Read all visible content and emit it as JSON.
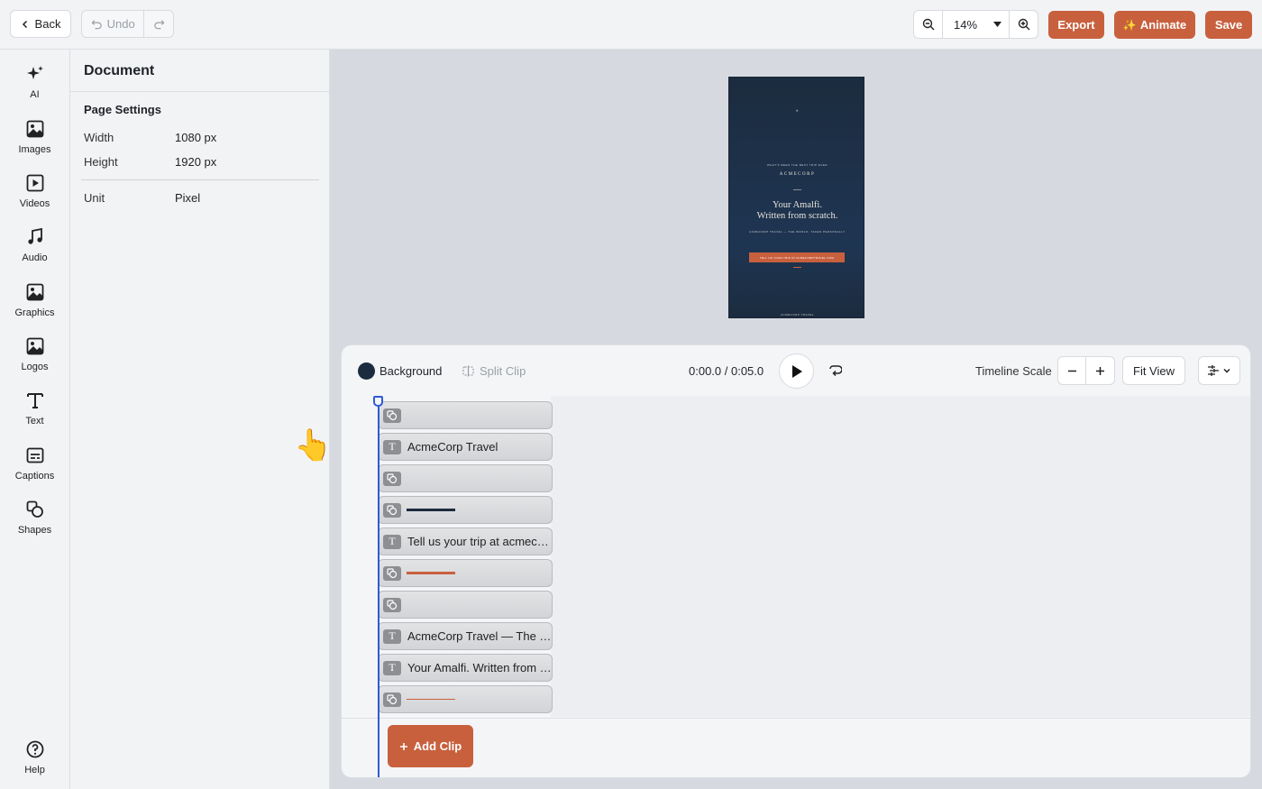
{
  "topbar": {
    "back_label": "Back",
    "undo_label": "Undo",
    "zoom_value": "14%",
    "export_label": "Export",
    "animate_label": "Animate",
    "save_label": "Save"
  },
  "rail": {
    "items": [
      {
        "label": "AI",
        "icon": "sparkle-icon"
      },
      {
        "label": "Images",
        "icon": "image-icon"
      },
      {
        "label": "Videos",
        "icon": "video-icon"
      },
      {
        "label": "Audio",
        "icon": "music-note-icon"
      },
      {
        "label": "Graphics",
        "icon": "graphics-icon"
      },
      {
        "label": "Logos",
        "icon": "logo-icon"
      },
      {
        "label": "Text",
        "icon": "text-icon"
      },
      {
        "label": "Captions",
        "icon": "captions-icon"
      },
      {
        "label": "Shapes",
        "icon": "shapes-icon"
      }
    ],
    "help_label": "Help"
  },
  "panel": {
    "title": "Document",
    "section": "Page Settings",
    "width_label": "Width",
    "width_value": "1080 px",
    "height_label": "Height",
    "height_value": "1920 px",
    "unit_label": "Unit",
    "unit_value": "Pixel"
  },
  "artboard": {
    "top_tagline": "WHAT'S BEEN THE BEST TRIP EVER",
    "logo": "ACMECORP",
    "headline_1": "Your Amalfi.",
    "headline_2": "Written from scratch.",
    "subline": "ACMECORP TRAVEL — THE WORLD, TAKEN PERSONALLY",
    "cta": "TELL US YOUR TRIP AT ACMECORPTRAVEL.COM",
    "footer": "ACMECORP TRAVEL",
    "bg_color": "#1c2c3f",
    "accent_color": "#c8603e"
  },
  "timeline": {
    "background_label": "Background",
    "background_color": "#1c2c3f",
    "split_clip_label": "Split Clip",
    "time_display": "0:00.0 / 0:05.0",
    "scale_label": "Timeline Scale",
    "fit_view_label": "Fit View",
    "add_clip_label": "Add Clip",
    "tracks": [
      {
        "kind": "shape",
        "text": ""
      },
      {
        "kind": "text",
        "text": "AcmeCorp Travel"
      },
      {
        "kind": "shape",
        "text": ""
      },
      {
        "kind": "shape-line",
        "text": "",
        "color": "#1c2c3f"
      },
      {
        "kind": "text",
        "text": "Tell us your trip at acmeco..."
      },
      {
        "kind": "shape-line",
        "text": "",
        "color": "#c8603e"
      },
      {
        "kind": "shape",
        "text": ""
      },
      {
        "kind": "text",
        "text": "AcmeCorp Travel — The w..."
      },
      {
        "kind": "text",
        "text": "Your Amalfi. Written from s..."
      },
      {
        "kind": "shape-thin",
        "text": "",
        "color": "#c8603e"
      }
    ]
  }
}
